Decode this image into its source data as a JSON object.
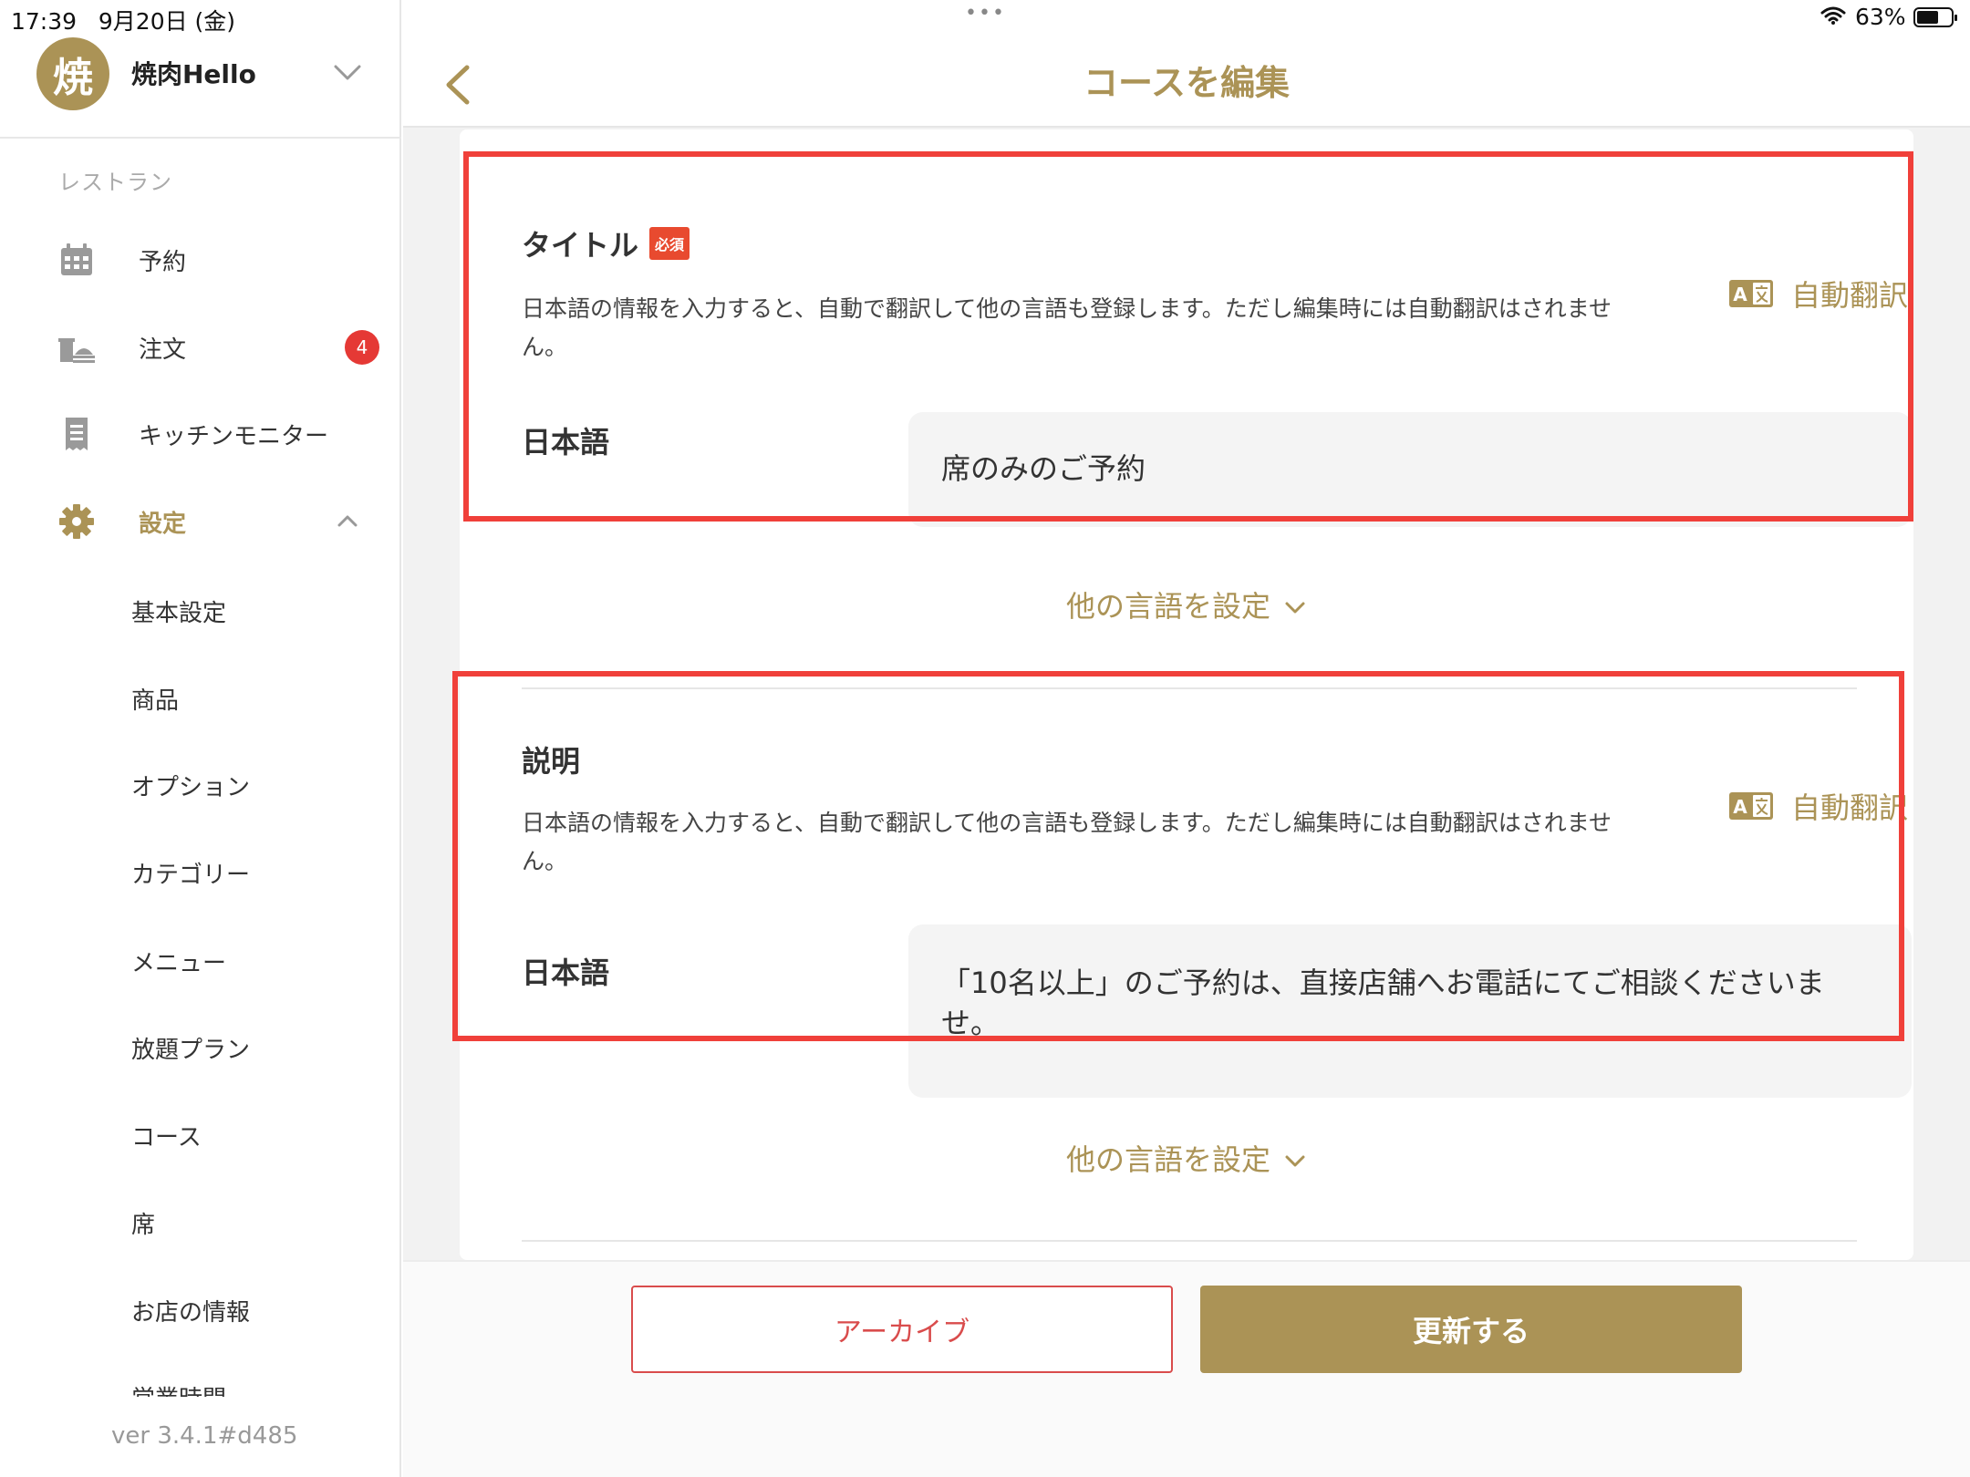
{
  "status_bar": {
    "time": "17:39",
    "date": "9月20日 (金)",
    "dots": "•••",
    "battery_percent": "63%",
    "battery_level": 0.63
  },
  "sidebar": {
    "avatar_char": "焼",
    "store_name": "焼肉Hello",
    "section_label": "レストラン",
    "nav": [
      {
        "label": "予約",
        "icon": "calendar-icon"
      },
      {
        "label": "注文",
        "icon": "food-tray-icon",
        "badge": "4"
      },
      {
        "label": "キッチンモニター",
        "icon": "receipt-icon"
      },
      {
        "label": "設定",
        "icon": "gear-icon"
      }
    ],
    "settings_items": [
      "基本設定",
      "商品",
      "オプション",
      "カテゴリー",
      "メニュー",
      "放題プラン",
      "コース",
      "席",
      "お店の情報",
      "営業時間"
    ],
    "version": "ver 3.4.1#d485"
  },
  "header": {
    "title": "コースを編集"
  },
  "form": {
    "title_section": {
      "label": "タイトル",
      "required_tag": "必須",
      "description": "日本語の情報を入力すると、自動で翻訳して他の言語も登録します。ただし編集時には自動翻訳はされません。",
      "auto_translate": "自動翻訳",
      "lang_label": "日本語",
      "value": "席のみのご予約",
      "other_languages": "他の言語を設定"
    },
    "description_section": {
      "label": "説明",
      "description": "日本語の情報を入力すると、自動で翻訳して他の言語も登録します。ただし編集時には自動翻訳はされません。",
      "auto_translate": "自動翻訳",
      "lang_label": "日本語",
      "value": "「10名以上」のご予約は、直接店舗へお電話にてご相談くださいませ。",
      "other_languages": "他の言語を設定"
    }
  },
  "footer": {
    "archive_label": "アーカイブ",
    "update_label": "更新する"
  },
  "colors": {
    "accent": "#ab9356",
    "highlight": "#f0403a",
    "badge": "#e53935"
  }
}
